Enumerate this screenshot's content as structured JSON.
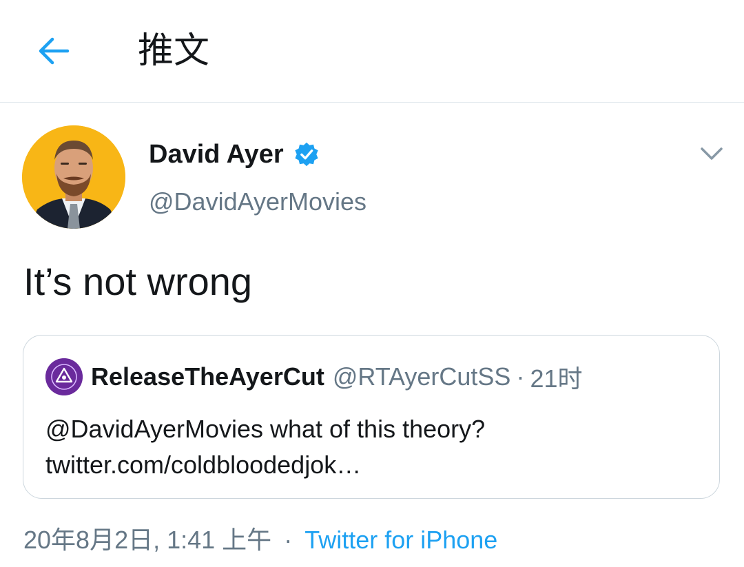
{
  "header": {
    "title": "推文",
    "back_icon": "arrow-left-icon"
  },
  "tweet": {
    "author": {
      "display_name": "David Ayer",
      "handle": "@DavidAyerMovies",
      "verified": true
    },
    "text": "It’s not wrong",
    "quoted": {
      "display_name": "ReleaseTheAyerCut",
      "handle": "@RTAyerCutSS",
      "separator": "·",
      "time": "21时",
      "text_line1": "@DavidAyerMovies what of this theory?",
      "text_line2": "twitter.com/coldbloodedjok…"
    },
    "timestamp": "20年8月2日, 1:41 上午",
    "separator": "·",
    "source": "Twitter for iPhone"
  },
  "colors": {
    "accent": "#1da1f2",
    "text_primary": "#14171a",
    "text_secondary": "#657786",
    "border": "#ccd6dd",
    "avatar_bg": "#f8b616"
  }
}
